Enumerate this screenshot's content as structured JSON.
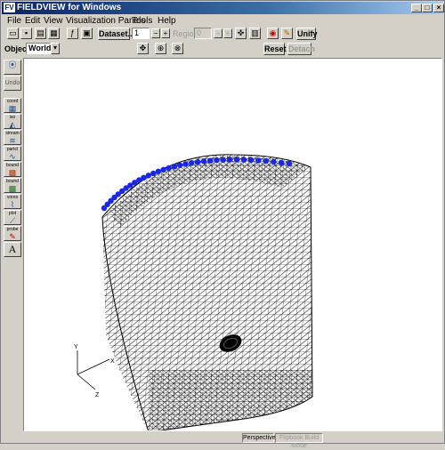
{
  "window": {
    "app_icon": "FV",
    "title": "FIELDVIEW for Windows",
    "minimize": "_",
    "maximize": "□",
    "close": "×"
  },
  "menu": {
    "items": [
      "File",
      "Edit",
      "View",
      "Visualization Panels",
      "Tools",
      "Help"
    ]
  },
  "toolbar": {
    "dataset_button": "Dataset...",
    "dataset_value": "1",
    "region_label": "Region:",
    "region_value": "0",
    "unify_button": "Unify",
    "icons": [
      "new-file-icon",
      "save-icon",
      "print-icon",
      "copy-icon",
      "script-icon",
      "screen-icon",
      "transform-icon",
      "colorbar-icon",
      "palette-icon",
      "wrench-icon"
    ]
  },
  "object_bar": {
    "label": "Object:",
    "value": "World",
    "reset_button": "Reset",
    "detach_button": "Detach",
    "mode_icons": [
      "translate-icon",
      "rotate-icon",
      "zoom-icon"
    ]
  },
  "sidebar": {
    "undo_label": "Undo",
    "tools": [
      {
        "name": "coord",
        "label": "coord"
      },
      {
        "name": "iso",
        "label": "iso"
      },
      {
        "name": "stream",
        "label": "stream"
      },
      {
        "name": "particle",
        "label": "partcl"
      },
      {
        "name": "bound",
        "label": "bound"
      },
      {
        "name": "bound2",
        "label": "bound"
      },
      {
        "name": "vortex",
        "label": "vorex"
      },
      {
        "name": "plot",
        "label": "plot"
      },
      {
        "name": "probe",
        "label": "probe"
      },
      {
        "name": "text",
        "label": "A"
      }
    ]
  },
  "viewport": {
    "axis_labels": {
      "y": "Y",
      "x": "X",
      "z": "Z"
    },
    "mesh_color": "#000000",
    "node_color": "#1a28e6"
  },
  "statusbar": {
    "perspective": "Perspective",
    "flipbook": "Flipbook Build Mode"
  }
}
